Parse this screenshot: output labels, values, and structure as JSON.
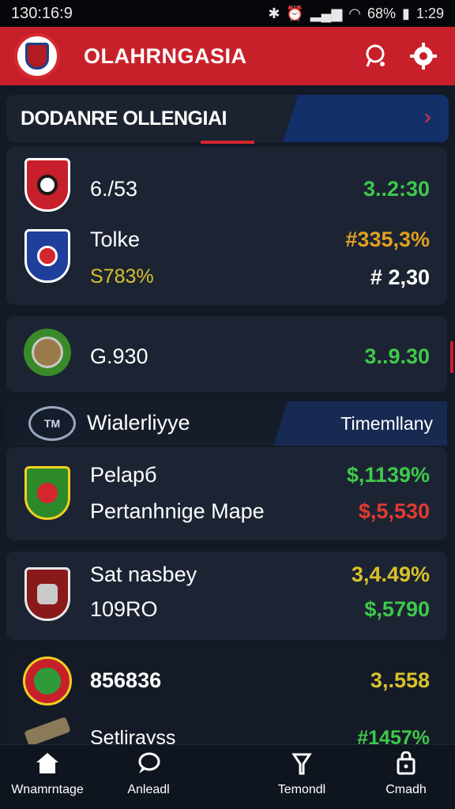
{
  "status_bar": {
    "time": "130:16:9",
    "icons": [
      "bluetooth-icon",
      "alarm-icon",
      "signal-icon",
      "wifi-icon",
      "battery-icon"
    ],
    "battery": "68%",
    "clock_right": "1:29"
  },
  "header": {
    "title": "OLAHRNGASIA",
    "icons": [
      "chat-icon",
      "settings-gear-icon"
    ],
    "brand_color": "#c8202a"
  },
  "section": {
    "title": "DODANRE OLLENGIAI",
    "chevron": "›"
  },
  "cards": [
    {
      "rows": [
        {
          "name": "6./53",
          "value": "3..2:30",
          "value_color": "green",
          "badge": "red-white-shield-icon"
        },
        {
          "name": "Tolke",
          "sub": "S783%",
          "value": "#335,3%",
          "value2": "# 2,30",
          "badge": "blue-red-shield-icon"
        }
      ]
    },
    {
      "rows": [
        {
          "name": "G.930",
          "value": "3..9.30",
          "value_color": "green",
          "badge": "green-ball-badge-icon"
        }
      ]
    }
  ],
  "group": {
    "icon_label": "TM",
    "title": "Wialerliyye",
    "right": "Timemllany"
  },
  "cards2": [
    {
      "rows": [
        {
          "name": "Pelapб",
          "value": "$,1139%",
          "value_color": "green",
          "badge": "green-yellow-shield-icon"
        },
        {
          "name": "Pertanhnige Mape",
          "value": "$,5,530",
          "value_color": "red"
        }
      ]
    },
    {
      "rows": [
        {
          "name": "Sat nasbey",
          "value": "3,4.49%",
          "value_color": "yellow",
          "badge": "red-knight-shield-icon"
        },
        {
          "name": "109RO",
          "value": "$,5790",
          "value_color": "green"
        }
      ]
    },
    {
      "rows": [
        {
          "name": "856836",
          "value": "3,.558",
          "value_color": "yellow",
          "badge": "round-green-red-crest-icon"
        },
        {
          "name": "Setlirayss",
          "value": "#1457%",
          "value_color": "green",
          "badge": "crossed-arms-icon"
        }
      ]
    }
  ],
  "bottom_nav": [
    {
      "label": "Wnamrntage",
      "icon": "home-icon"
    },
    {
      "label": "Anleadl",
      "icon": "chat-bubble-icon"
    },
    {
      "label": "Temondl",
      "icon": "microphone-icon"
    },
    {
      "label": "Cmadh",
      "icon": "lock-bag-icon"
    }
  ]
}
